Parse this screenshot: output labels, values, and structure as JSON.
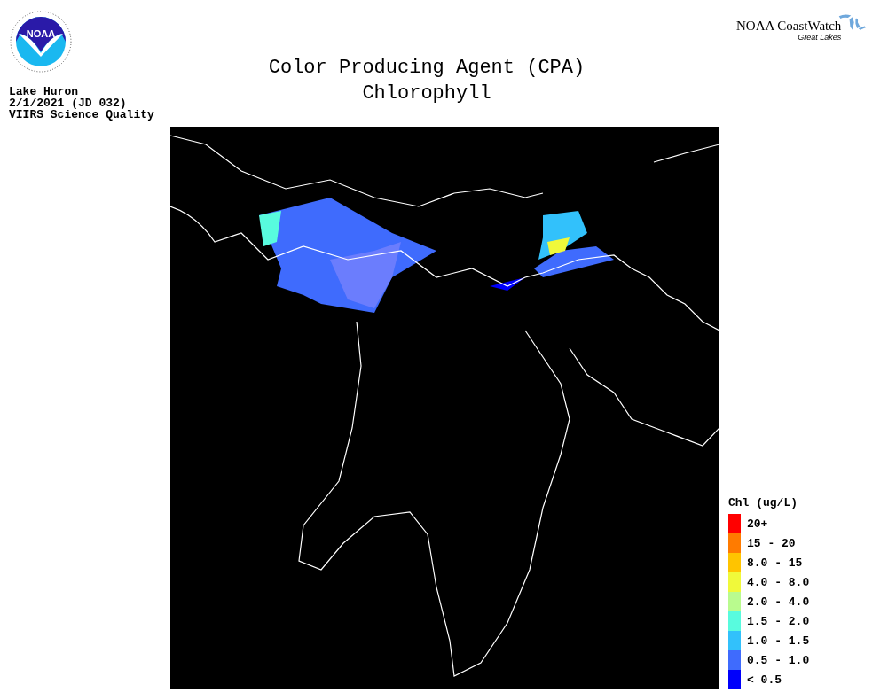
{
  "logo": {
    "text": "NOAA"
  },
  "brand": {
    "name": "NOAA CoastWatch",
    "subtitle": "Great Lakes"
  },
  "title": [
    "Color Producing Agent (CPA)",
    "Chlorophyll"
  ],
  "info": [
    "Lake Huron",
    "2/1/2021 (JD 032)",
    "VIIRS Science Quality"
  ],
  "legend": {
    "title": "Chl (ug/L)",
    "items": [
      {
        "label": "20+",
        "color": "#ff0000"
      },
      {
        "label": "15 - 20",
        "color": "#ff7b00"
      },
      {
        "label": "8.0 - 15",
        "color": "#ffc400"
      },
      {
        "label": "4.0 - 8.0",
        "color": "#f0f93a"
      },
      {
        "label": "2.0 - 4.0",
        "color": "#b9fb8e"
      },
      {
        "label": "1.5 - 2.0",
        "color": "#58fbde"
      },
      {
        "label": "1.0 - 1.5",
        "color": "#32c1fb"
      },
      {
        "label": "0.5 - 1.0",
        "color": "#3f6bfd"
      },
      {
        "label": "< 0.5",
        "color": "#0000fb"
      }
    ]
  }
}
